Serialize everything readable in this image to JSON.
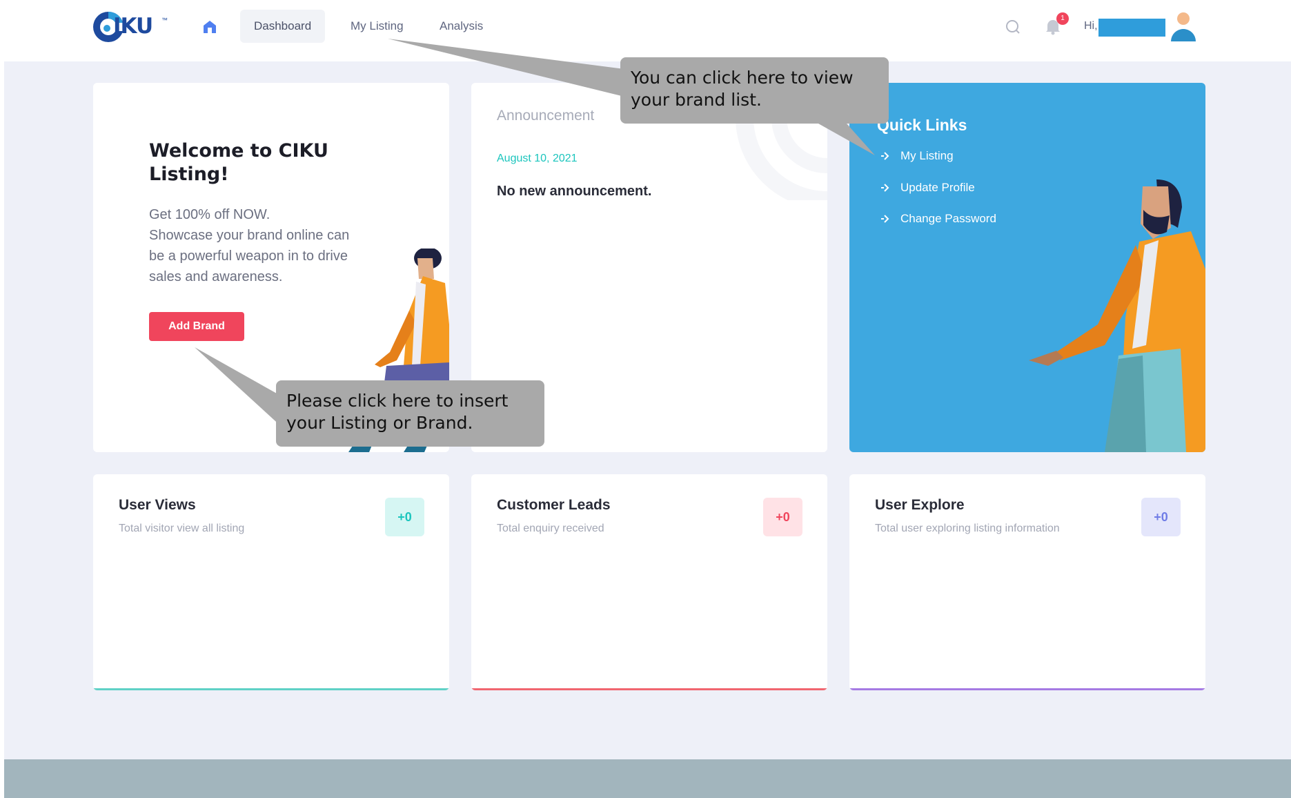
{
  "header": {
    "logo_text": "IKU",
    "logo_tm": "™",
    "nav": [
      {
        "label": "Dashboard"
      },
      {
        "label": "My Listing"
      },
      {
        "label": "Analysis"
      }
    ],
    "notification_count": "1",
    "greeting": "Hi,"
  },
  "welcome": {
    "title": "Welcome to CIKU Listing!",
    "lines": [
      "Get 100% off NOW.",
      "Showcase your brand online can",
      "be a powerful weapon in to drive",
      "sales and awareness."
    ],
    "button_label": "Add Brand"
  },
  "announcement": {
    "label": "Announcement",
    "date": "August 10, 2021",
    "message": "No new announcement."
  },
  "quick_links": {
    "title": "Quick Links",
    "items": [
      {
        "label": "My Listing"
      },
      {
        "label": "Update Profile"
      },
      {
        "label": "Change Password"
      }
    ]
  },
  "stats": [
    {
      "title": "User Views",
      "subtitle": "Total visitor view all listing",
      "value": "+0",
      "color": "#1bc5bd"
    },
    {
      "title": "Customer Leads",
      "subtitle": "Total enquiry received",
      "value": "+0",
      "color": "#f0455c"
    },
    {
      "title": "User Explore",
      "subtitle": "Total user exploring listing information",
      "value": "+0",
      "color": "#6f7ce6"
    }
  ],
  "tooltips": {
    "brand_list": {
      "line1": "You can click here to view",
      "line2": "your brand list."
    },
    "add_brand": {
      "line1": "Please click here to insert",
      "line2": "your Listing or Brand."
    }
  },
  "icons": [
    "home-icon",
    "search-icon",
    "bell-icon",
    "avatar",
    "chevron-right-icon"
  ]
}
